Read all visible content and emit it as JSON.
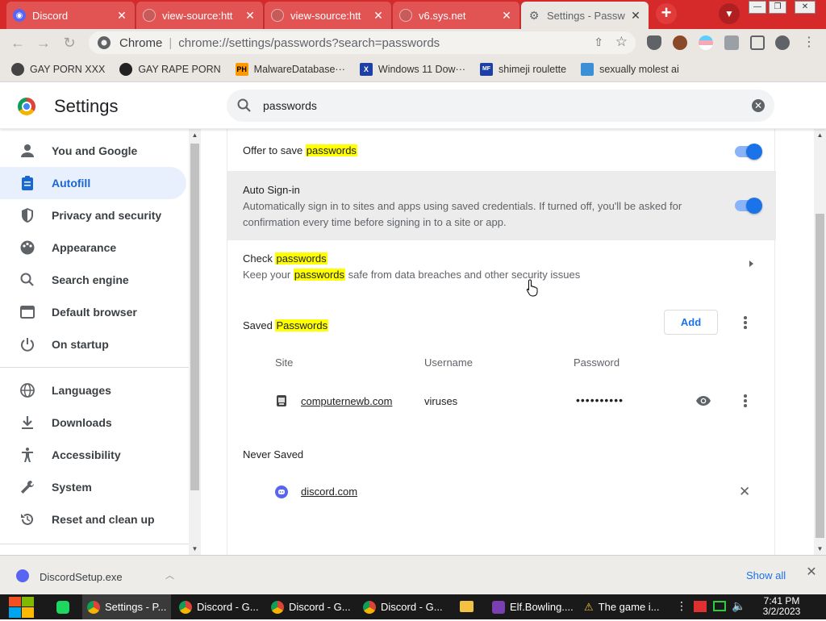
{
  "browser": {
    "tabs": [
      {
        "title": "Discord",
        "icon": "discord-icon",
        "color": "#5865f2"
      },
      {
        "title": "view-source:htt",
        "icon": "globe-icon",
        "color": "#a04040"
      },
      {
        "title": "view-source:htt",
        "icon": "globe-icon",
        "color": "#a04040"
      },
      {
        "title": "v6.sys.net",
        "icon": "globe-icon",
        "color": "#a04040"
      },
      {
        "title": "Settings - Passw",
        "icon": "gear-icon",
        "color": "#5f6368"
      }
    ],
    "new_tab_symbol": "+",
    "address_bar": {
      "origin": "Chrome",
      "url": "chrome://settings/passwords?search=passwords"
    },
    "bookmarks": [
      {
        "label": "GAY PORN XXX",
        "icon": "bookmark-icon-1"
      },
      {
        "label": "GAY RAPE PORN",
        "icon": "bookmark-icon-2"
      },
      {
        "label": "MalwareDatabase···",
        "icon": "ph-icon"
      },
      {
        "label": "Windows 11 Dow···",
        "icon": "x-icon"
      },
      {
        "label": "shimeji roulette",
        "icon": "mft-icon"
      },
      {
        "label": "sexually molest ai",
        "icon": "ai-icon"
      }
    ]
  },
  "settings": {
    "title": "Settings",
    "search": {
      "value": "passwords"
    },
    "nav": [
      {
        "label": "You and Google",
        "icon": "person-icon"
      },
      {
        "label": "Autofill",
        "icon": "clipboard-icon",
        "selected": true
      },
      {
        "label": "Privacy and security",
        "icon": "shield-icon"
      },
      {
        "label": "Appearance",
        "icon": "palette-icon"
      },
      {
        "label": "Search engine",
        "icon": "search-icon"
      },
      {
        "label": "Default browser",
        "icon": "browser-icon"
      },
      {
        "label": "On startup",
        "icon": "power-icon"
      },
      {
        "label": "Languages",
        "icon": "globe-icon"
      },
      {
        "label": "Downloads",
        "icon": "download-icon"
      },
      {
        "label": "Accessibility",
        "icon": "accessibility-icon"
      },
      {
        "label": "System",
        "icon": "wrench-icon"
      },
      {
        "label": "Reset and clean up",
        "icon": "reset-icon"
      }
    ],
    "passwords": {
      "offer_to_save": {
        "prefix": "Offer to save ",
        "highlight": "passwords",
        "enabled": true
      },
      "auto_signin": {
        "title": "Auto Sign-in",
        "description": "Automatically sign in to sites and apps using saved credentials. If turned off, you'll be asked for confirmation every time before signing in to a site or app.",
        "enabled": true
      },
      "check": {
        "title_prefix": "Check ",
        "title_highlight": "passwords",
        "desc_prefix": "Keep your ",
        "desc_highlight": "passwords",
        "desc_suffix": " safe from data breaches and other security issues"
      },
      "saved_heading_prefix": "Saved ",
      "saved_heading_highlight": "Passwords",
      "add_label": "Add",
      "columns": {
        "site": "Site",
        "username": "Username",
        "password": "Password"
      },
      "saved": [
        {
          "site": "computernewb.com",
          "username": "viruses",
          "password": "••••••••••"
        }
      ],
      "never_saved_heading": "Never Saved",
      "never_saved": [
        {
          "site": "discord.com"
        }
      ]
    }
  },
  "download_shelf": {
    "file": "DiscordSetup.exe",
    "show_all": "Show all"
  },
  "taskbar": {
    "items": [
      {
        "label": "Settings - P...",
        "icon": "chrome-icon",
        "active": true
      },
      {
        "label": "Discord - G...",
        "icon": "chrome-icon"
      },
      {
        "label": "Discord - G...",
        "icon": "chrome-icon"
      },
      {
        "label": "Discord - G...",
        "icon": "chrome-icon"
      },
      {
        "label": "Elf.Bowling....",
        "icon": "media-icon"
      },
      {
        "label": "The game i...",
        "icon": "warning-icon"
      }
    ],
    "time": "7:41 PM",
    "date": "3/2/2023"
  }
}
